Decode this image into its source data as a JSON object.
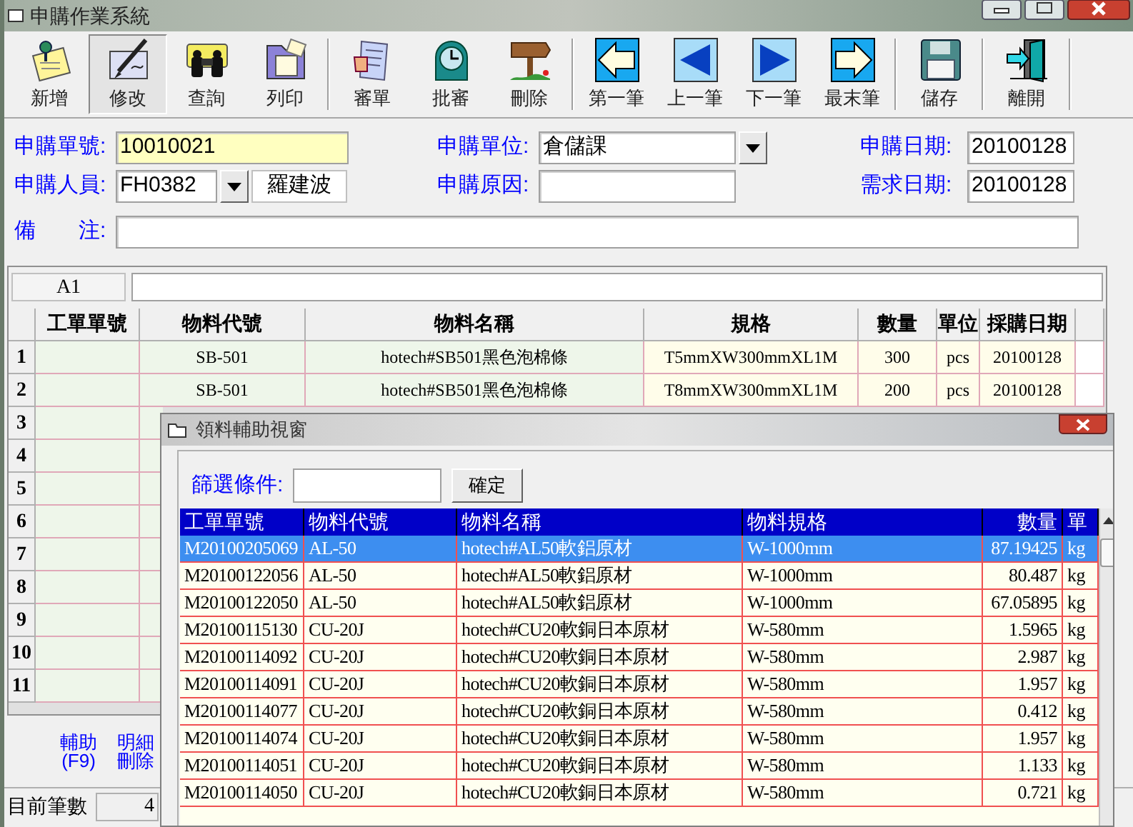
{
  "window": {
    "title": "申購作業系統"
  },
  "toolbar": [
    {
      "buttons": [
        {
          "label": "新增",
          "kind": "note",
          "pressed": false
        },
        {
          "label": "修改",
          "kind": "pen",
          "pressed": true
        },
        {
          "label": "查詢",
          "kind": "binoculars",
          "pressed": false
        },
        {
          "label": "列印",
          "kind": "folder",
          "pressed": false
        }
      ]
    },
    {
      "buttons": [
        {
          "label": "審單",
          "kind": "document",
          "pressed": false
        },
        {
          "label": "批審",
          "kind": "clock",
          "pressed": false
        },
        {
          "label": "刪除",
          "kind": "signpost",
          "pressed": false
        }
      ]
    },
    {
      "buttons": [
        {
          "label": "第一筆",
          "kind": "first",
          "pressed": false
        },
        {
          "label": "上一筆",
          "kind": "prev",
          "pressed": false
        },
        {
          "label": "下一筆",
          "kind": "next",
          "pressed": false
        },
        {
          "label": "最末筆",
          "kind": "last",
          "pressed": false
        }
      ]
    },
    {
      "buttons": [
        {
          "label": "儲存",
          "kind": "floppy",
          "pressed": false
        }
      ]
    },
    {
      "buttons": [
        {
          "label": "離開",
          "kind": "door",
          "pressed": false
        }
      ]
    }
  ],
  "form": {
    "rows": [
      {
        "fields": [
          {
            "label": "申購單號:",
            "kind": "text",
            "value": "10010021",
            "highlighted": true
          },
          {
            "label": "申購單位:",
            "kind": "dropdown",
            "value": "倉儲課",
            "highlighted": false
          },
          {
            "label": "申購日期:",
            "kind": "text",
            "value": "20100128",
            "highlighted": false
          }
        ]
      },
      {
        "fields": [
          {
            "label": "申購人員:",
            "kind": "lookup",
            "value": "FH0382",
            "display": "羅建波",
            "highlighted": false
          },
          {
            "label": "申購原因:",
            "kind": "text",
            "highlighted": false
          },
          {
            "label": "需求日期:",
            "kind": "text",
            "value": "20100128",
            "highlighted": false
          }
        ]
      },
      {
        "fields": [
          {
            "label": "備　　注:",
            "kind": "text",
            "highlighted": false
          }
        ]
      }
    ]
  },
  "grid": {
    "cell_ref": "A1",
    "columns": [
      "工單單號",
      "物料代號",
      "物料名稱",
      "規格",
      "數量",
      "單位",
      "採購日期"
    ],
    "rows": [
      {
        "number": "1",
        "material_code": "SB-501",
        "material_name": "hotech#SB501黑色泡棉條",
        "spec": "T5mmXW300mmXL1M",
        "quantity": "300",
        "unit": "pcs",
        "purchase_date": "20100128"
      },
      {
        "number": "2",
        "material_code": "SB-501",
        "material_name": "hotech#SB501黑色泡棉條",
        "spec": "T8mmXW300mmXL1M",
        "quantity": "200",
        "unit": "pcs",
        "purchase_date": "20100128"
      },
      {
        "number": "3"
      },
      {
        "number": "4"
      },
      {
        "number": "5"
      },
      {
        "number": "6"
      },
      {
        "number": "7"
      },
      {
        "number": "8"
      },
      {
        "number": "9"
      },
      {
        "number": "10"
      },
      {
        "number": "11"
      }
    ]
  },
  "bottom_buttons": [
    "輔助(F9)",
    "明細刪除"
  ],
  "status_bar": {
    "label": "目前筆數",
    "value": "4"
  },
  "dialog": {
    "title": "領料輔助視窗",
    "filter_label": "篩選條件:",
    "confirm": "確定",
    "columns": [
      "工單單號",
      "物料代號",
      "物料名稱",
      "物料規格",
      "數量",
      "單"
    ],
    "rows": [
      {
        "cells": [
          "M20100205069",
          "AL-50",
          "hotech#AL50軟鋁原材",
          "W-1000mm",
          "87.19425",
          "kg"
        ],
        "selected": true
      },
      {
        "cells": [
          "M20100122056",
          "AL-50",
          "hotech#AL50軟鋁原材",
          "W-1000mm",
          "80.487",
          "kg"
        ],
        "selected": false
      },
      {
        "cells": [
          "M20100122050",
          "AL-50",
          "hotech#AL50軟鋁原材",
          "W-1000mm",
          "67.05895",
          "kg"
        ],
        "selected": false
      },
      {
        "cells": [
          "M20100115130",
          "CU-20J",
          "hotech#CU20軟銅日本原材",
          "W-580mm",
          "1.5965",
          "kg"
        ],
        "selected": false
      },
      {
        "cells": [
          "M20100114092",
          "CU-20J",
          "hotech#CU20軟銅日本原材",
          "W-580mm",
          "2.987",
          "kg"
        ],
        "selected": false
      },
      {
        "cells": [
          "M20100114091",
          "CU-20J",
          "hotech#CU20軟銅日本原材",
          "W-580mm",
          "1.957",
          "kg"
        ],
        "selected": false
      },
      {
        "cells": [
          "M20100114077",
          "CU-20J",
          "hotech#CU20軟銅日本原材",
          "W-580mm",
          "0.412",
          "kg"
        ],
        "selected": false
      },
      {
        "cells": [
          "M20100114074",
          "CU-20J",
          "hotech#CU20軟銅日本原材",
          "W-580mm",
          "1.957",
          "kg"
        ],
        "selected": false
      },
      {
        "cells": [
          "M20100114051",
          "CU-20J",
          "hotech#CU20軟銅日本原材",
          "W-580mm",
          "1.133",
          "kg"
        ],
        "selected": false
      },
      {
        "cells": [
          "M20100114050",
          "CU-20J",
          "hotech#CU20軟銅日本原材",
          "W-580mm",
          "0.721",
          "kg"
        ],
        "selected": false
      }
    ]
  }
}
